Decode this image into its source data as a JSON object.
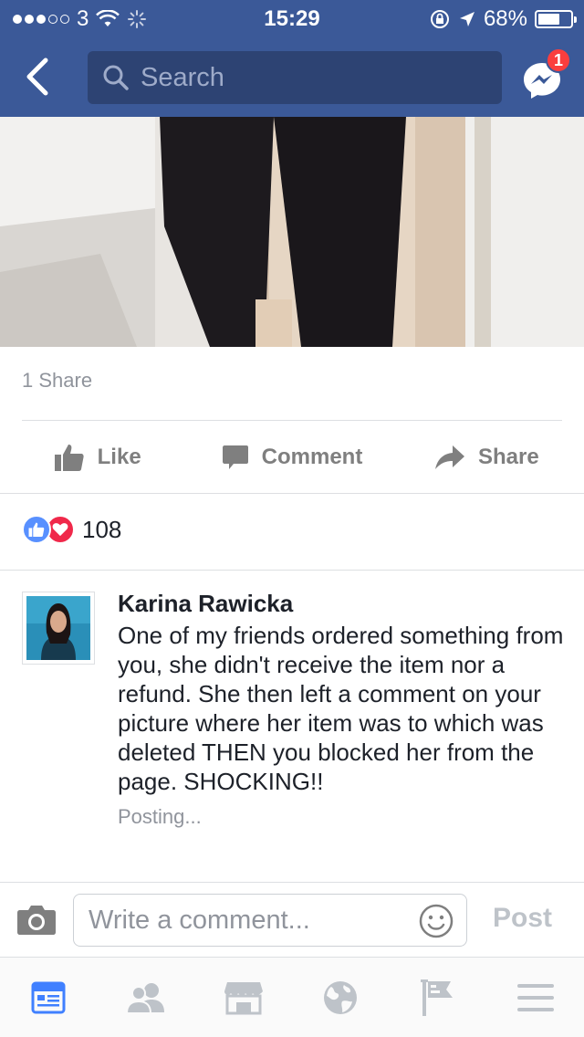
{
  "status_bar": {
    "carrier": "3",
    "time": "15:29",
    "battery": "68%",
    "battery_level": 0.68
  },
  "nav": {
    "search_placeholder": "Search",
    "messenger_badge": "1"
  },
  "post": {
    "shares": "1 Share",
    "actions": {
      "like": "Like",
      "comment": "Comment",
      "share": "Share"
    },
    "reaction_count": "108"
  },
  "comment": {
    "author": "Karina Rawicka",
    "text": "One of my friends ordered something from you, she didn't receive the item nor a refund. She then left a comment on your picture where her item was to which was deleted THEN you blocked her from the page. SHOCKING!!",
    "status": "Posting..."
  },
  "composer": {
    "placeholder": "Write a comment...",
    "post_label": "Post"
  },
  "tabs": [
    {
      "icon": "news-feed-icon",
      "active": true
    },
    {
      "icon": "friends-icon",
      "active": false
    },
    {
      "icon": "marketplace-icon",
      "active": false
    },
    {
      "icon": "globe-icon",
      "active": false
    },
    {
      "icon": "pages-flag-icon",
      "active": false
    },
    {
      "icon": "menu-icon",
      "active": false
    }
  ],
  "colors": {
    "brand": "#3b5998",
    "active_tab": "#4080ff",
    "inactive_icon": "#bec3c9",
    "badge": "#fa3e3e"
  }
}
